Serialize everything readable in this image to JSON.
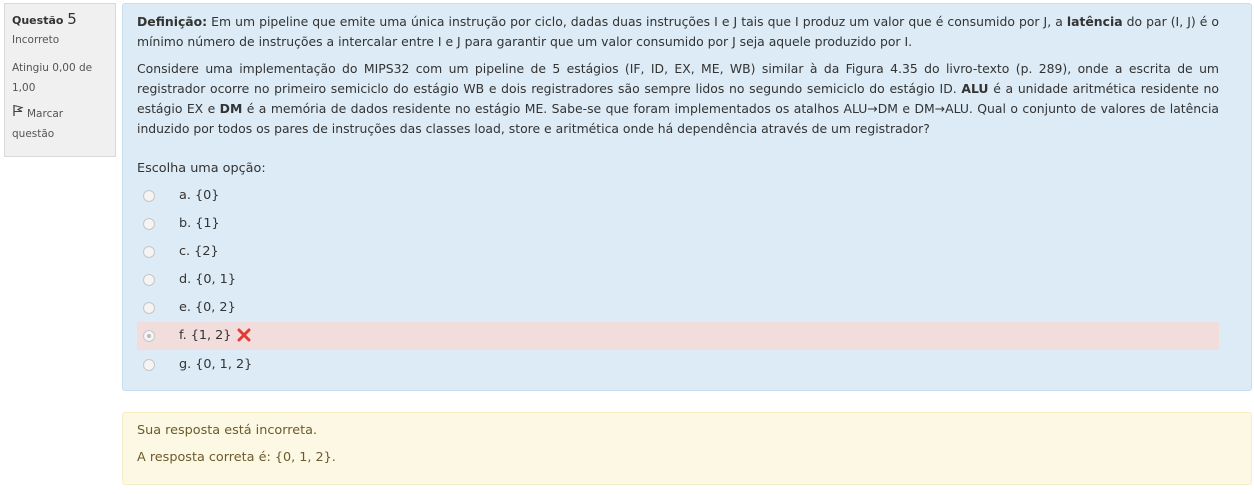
{
  "info": {
    "question_label": "Questão",
    "question_number": "5",
    "state": "Incorreto",
    "grade_line1": "Atingiu 0,00 de",
    "grade_line2": "1,00",
    "flag_line1": "Marcar",
    "flag_line2": "questão"
  },
  "question": {
    "p1": {
      "def_label": "Definição:",
      "t1": " Em um pipeline que emite uma única instrução por ciclo, dadas duas instruções I e J tais que I produz um valor que é consumido por J, a ",
      "bold_latency": "latência",
      "t2": " do par (I, J) é o mínimo número de instruções a intercalar entre I e J para garantir que um valor consumido por J seja aquele produzido por I."
    },
    "p2": {
      "t1": "Considere uma implementação do MIPS32 com um pipeline de 5 estágios (IF, ID, EX, ME, WB) similar à da Figura 4.35 do livro-texto (p. 289), onde a escrita de um registrador ocorre no primeiro semiciclo do estágio WB e dois registradores são sempre lidos no segundo semiciclo do estágio ID. ",
      "bold_alu": "ALU",
      "t2": " é a unidade aritmética residente no estágio EX e ",
      "bold_dm": "DM",
      "t3": " é a memória de dados residente no estágio ME. Sabe-se que foram implementados os atalhos ALU→DM e DM→ALU. Qual o conjunto de valores de latência induzido por todos os pares de instruções das classes load, store e aritmética onde há dependência através de um registrador?"
    },
    "prompt": "Escolha uma opção:",
    "options": [
      {
        "label": "a. {0}"
      },
      {
        "label": "b. {1}"
      },
      {
        "label": "c. {2}"
      },
      {
        "label": "d. {0, 1}"
      },
      {
        "label": "e. {0, 2}"
      },
      {
        "label": "f. {1, 2}"
      },
      {
        "label": "g. {0, 1, 2}"
      }
    ],
    "selected_option": "f",
    "wrong_color": "#e53935"
  },
  "feedback": {
    "line1": "Sua resposta está incorreta.",
    "line2": "A resposta correta é: {0, 1, 2}."
  }
}
